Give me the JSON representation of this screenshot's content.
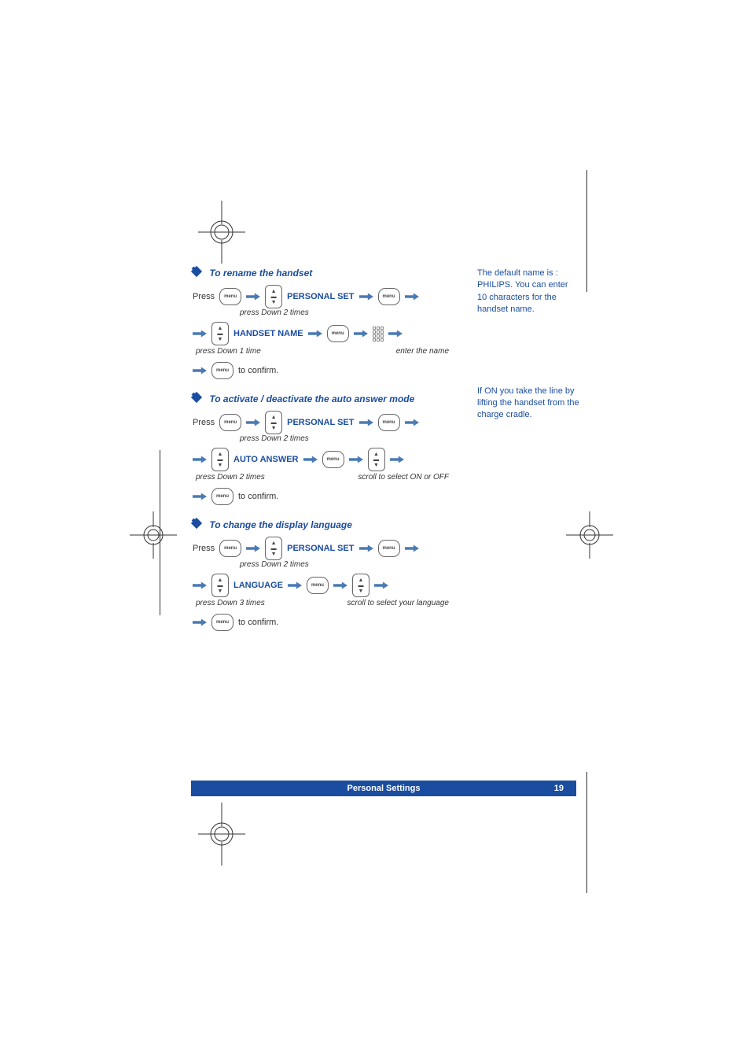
{
  "sections": {
    "rename": {
      "title": "To rename the handset",
      "press": "Press",
      "personal_set": "PERSONAL SET",
      "press_down_2": "press Down 2 times",
      "handset_name": "HANDSET NAME",
      "press_down_1": "press Down 1 time",
      "enter_name": "enter the name",
      "confirm": "to confirm."
    },
    "auto_answer": {
      "title": "To activate / deactivate the auto answer mode",
      "press": "Press",
      "personal_set": "PERSONAL SET",
      "press_down_2": "press Down 2 times",
      "auto_answer": "AUTO ANSWER",
      "press_down_2b": "press Down 2 times",
      "scroll": "scroll to select ON or OFF",
      "confirm": "to confirm."
    },
    "language": {
      "title": "To change the display language",
      "press": "Press",
      "personal_set": "PERSONAL SET",
      "press_down_2": "press Down 2 times",
      "language": "LANGUAGE",
      "press_down_3": "press Down 3 times",
      "scroll": "scroll to select your language",
      "confirm": "to confirm."
    }
  },
  "side_notes": {
    "note1": "The default name is : PHILIPS. You can enter 10 characters for the handset name.",
    "note2": "If ON you take the line by lifting the handset from the charge cradle."
  },
  "footer": {
    "title": "Personal Settings",
    "page": "19"
  },
  "icons": {
    "menu_label": "menu"
  }
}
